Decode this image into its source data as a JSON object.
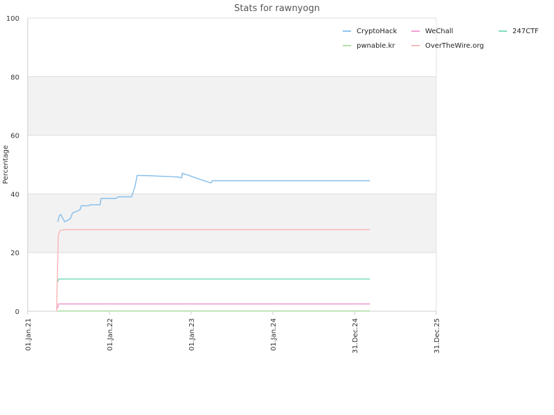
{
  "chart_data": {
    "type": "line",
    "title": "Stats for rawnyogn",
    "xlabel": "",
    "ylabel": "Percentage",
    "xlim": [
      "2021-01-01",
      "2025-12-31"
    ],
    "ylim": [
      0,
      100
    ],
    "y_ticks": [
      0,
      20,
      40,
      60,
      80,
      100
    ],
    "x_ticks": [
      {
        "date": "2021-01-01",
        "label": "01.Jan.21"
      },
      {
        "date": "2022-01-01",
        "label": "01.Jan.22"
      },
      {
        "date": "2023-01-01",
        "label": "01.Jan.23"
      },
      {
        "date": "2024-01-01",
        "label": "01.Jan.24"
      },
      {
        "date": "2024-12-31",
        "label": "31.Dec.24"
      },
      {
        "date": "2025-12-31",
        "label": "31.Dec.25"
      }
    ],
    "grid": "horizontal, alternating shaded bands",
    "legend_position": "top-right",
    "series": [
      {
        "name": "CryptoHack",
        "color": "#8fc3ec",
        "points": [
          [
            "2021-05-15",
            30.5
          ],
          [
            "2021-05-22",
            32.5
          ],
          [
            "2021-05-29",
            33.0
          ],
          [
            "2021-06-08",
            31.5
          ],
          [
            "2021-06-15",
            30.5
          ],
          [
            "2021-07-10",
            31.5
          ],
          [
            "2021-07-20",
            33.5
          ],
          [
            "2021-08-20",
            34.5
          ],
          [
            "2021-08-25",
            35.0
          ],
          [
            "2021-08-28",
            36.0
          ],
          [
            "2021-09-30",
            36.0
          ],
          [
            "2021-10-05",
            36.3
          ],
          [
            "2021-11-20",
            36.3
          ],
          [
            "2021-11-25",
            38.5
          ],
          [
            "2022-02-01",
            38.5
          ],
          [
            "2022-02-10",
            39.0
          ],
          [
            "2022-04-10",
            39.0
          ],
          [
            "2022-04-25",
            42.5
          ],
          [
            "2022-05-05",
            46.3
          ],
          [
            "2022-05-20",
            46.3
          ],
          [
            "2022-07-01",
            46.2
          ],
          [
            "2022-09-01",
            46.0
          ],
          [
            "2022-11-01",
            45.8
          ],
          [
            "2022-11-20",
            45.5
          ],
          [
            "2022-11-22",
            47.0
          ],
          [
            "2022-12-15",
            46.5
          ],
          [
            "2023-02-01",
            45.2
          ],
          [
            "2023-03-20",
            44.0
          ],
          [
            "2023-04-01",
            43.8
          ],
          [
            "2023-04-05",
            44.5
          ],
          [
            "2024-01-01",
            44.5
          ],
          [
            "2024-12-31",
            44.5
          ],
          [
            "2025-03-10",
            44.5
          ]
        ]
      },
      {
        "name": "WeChall",
        "color": "#ef9fce",
        "points": [
          [
            "2021-05-15",
            1.0
          ],
          [
            "2021-05-18",
            2.5
          ],
          [
            "2022-01-01",
            2.5
          ],
          [
            "2024-01-01",
            2.5
          ],
          [
            "2025-03-10",
            2.5
          ]
        ]
      },
      {
        "name": "247CTF",
        "color": "#7fdcc0",
        "points": [
          [
            "2021-05-15",
            10.0
          ],
          [
            "2021-05-20",
            11.0
          ],
          [
            "2022-01-01",
            11.0
          ],
          [
            "2024-01-01",
            11.0
          ],
          [
            "2025-03-10",
            11.0
          ]
        ]
      },
      {
        "name": "pwnable.kr",
        "color": "#b0e2a6",
        "points": [
          [
            "2021-05-15",
            0.1
          ],
          [
            "2022-01-01",
            0.1
          ],
          [
            "2025-03-10",
            0.1
          ]
        ]
      },
      {
        "name": "OverTheWire.org",
        "color": "#f7bcbc",
        "points": [
          [
            "2021-05-10",
            0.0
          ],
          [
            "2021-05-14",
            14.0
          ],
          [
            "2021-05-18",
            26.0
          ],
          [
            "2021-05-25",
            27.5
          ],
          [
            "2021-06-10",
            27.8
          ],
          [
            "2022-01-01",
            27.8
          ],
          [
            "2024-01-01",
            27.8
          ],
          [
            "2025-03-10",
            27.8
          ]
        ]
      }
    ]
  }
}
